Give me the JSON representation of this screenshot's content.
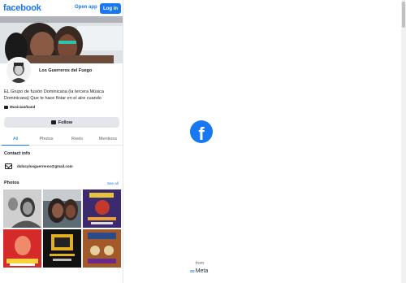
{
  "header": {
    "logo": "facebook",
    "open_app": "Open app",
    "login": "Log in"
  },
  "profile": {
    "name": "Los Guerreros del Fuego",
    "bio": "EL Grupo de fusión Dominicana (la tercera Música Dominicana) Que te hace flotar en el aire cuando",
    "category": "Musician/band",
    "follow_label": "Follow"
  },
  "tabs": [
    {
      "label": "All",
      "active": true
    },
    {
      "label": "Photos",
      "active": false
    },
    {
      "label": "Reels",
      "active": false
    },
    {
      "label": "Mentions",
      "active": false
    }
  ],
  "contact": {
    "heading": "Contact info",
    "email": "dulucylosguerreros@gmail.com"
  },
  "photos": {
    "heading": "Photos",
    "see_all": "See all"
  },
  "right_panel": {
    "fb_glyph": "f",
    "from": "from",
    "meta": "Meta",
    "meta_icon": "∞"
  },
  "colors": {
    "brand": "#1877f2",
    "text": "#1c1e21",
    "secondary": "#65676b"
  }
}
